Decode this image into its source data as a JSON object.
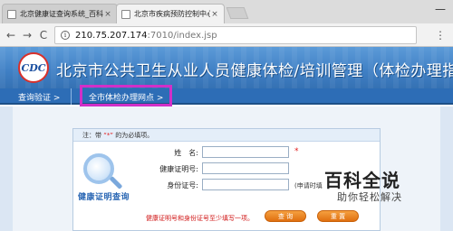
{
  "browser": {
    "tabs": [
      {
        "label": "北京健康证查询系统_百科",
        "active": false
      },
      {
        "label": "北京市疾病预防控制中心",
        "active": true
      }
    ],
    "tab_close": "×",
    "minimize": "—",
    "back": "←",
    "forward": "→",
    "reload": "C",
    "info": "i",
    "url_host": "210.75.207.174",
    "url_path": ":7010/index.jsp",
    "menu": "⋮"
  },
  "header": {
    "logo_text": "CDC",
    "title": "北京市公共卫生从业人员健康体检/培训管理（体检办理指南）"
  },
  "nav": {
    "items": [
      "查询验证 >",
      "全市体检办理网点 >"
    ]
  },
  "form": {
    "note_prefix": "注：带",
    "note_star": "“*”",
    "note_suffix": "的为必填项。",
    "fields": [
      {
        "label": "姓　名:",
        "value": "",
        "required_mark": "*"
      },
      {
        "label": "健康证明号:",
        "value": ""
      },
      {
        "label": "身份证号:",
        "value": "",
        "hint": "(申请时填"
      }
    ],
    "warning": "健康证明号和身份证号至少填写一项。",
    "buttons": {
      "query": "查 询",
      "reset": "重 置"
    }
  },
  "query_art": {
    "label": "健康证明查询"
  },
  "watermark": {
    "main": "百科全说",
    "sub": "助你轻松解决"
  },
  "colors": {
    "banner_blue": "#3f7fc4",
    "nav_blue": "#2d6db6",
    "highlight": "#d12fc8",
    "required_red": "#e21b1b",
    "button_orange": "#e07010"
  }
}
